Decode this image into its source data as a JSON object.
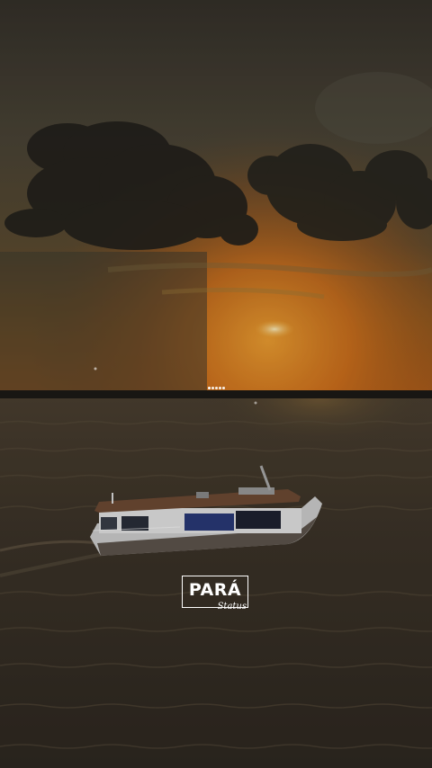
{
  "logo": {
    "word": "PARÁ",
    "script": "Status"
  },
  "pager": {
    "count": 5,
    "active_index": 0
  },
  "colors": {
    "sky_top": "#3a352a",
    "sunset_orange": "#c8661a",
    "sun_glow": "#f0a030",
    "water": "#3c352b",
    "boat_hull": "#d9d9d9",
    "boat_roof": "#6e4a34",
    "boat_blue": "#2a3a78"
  }
}
